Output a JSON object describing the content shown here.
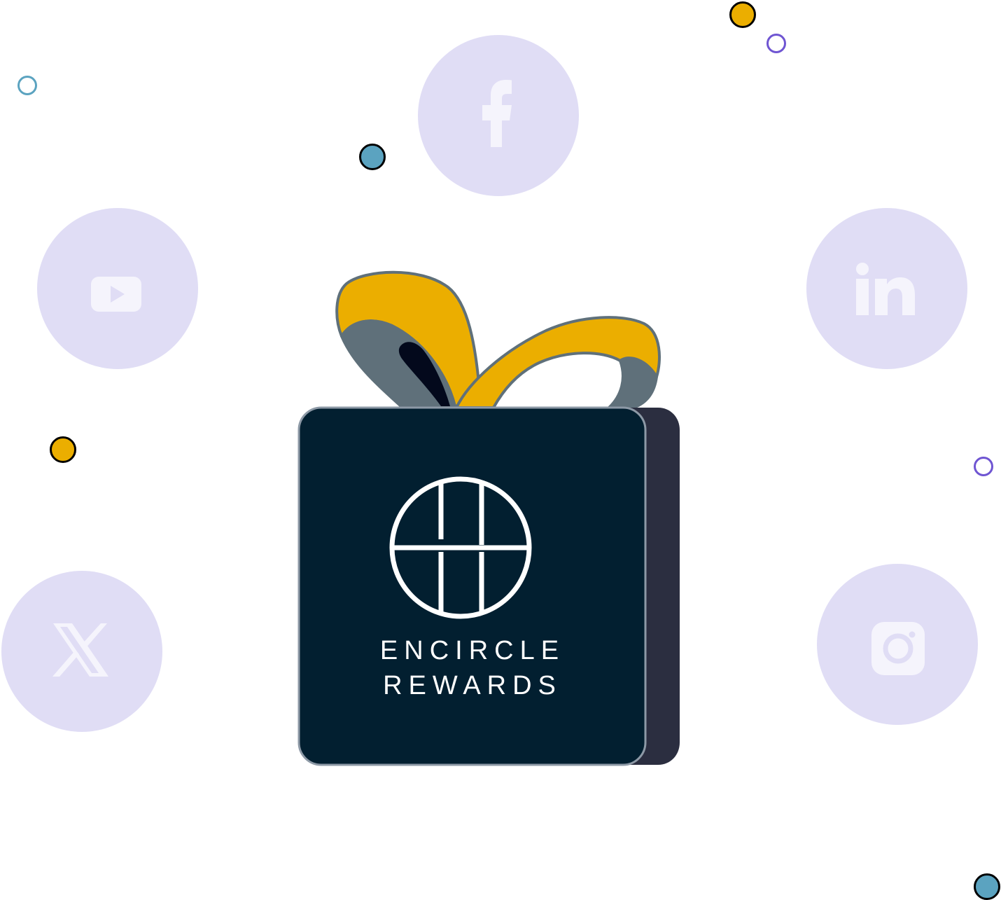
{
  "brand": {
    "line1": "ENCIRCLE",
    "line2": "REWARDS"
  },
  "social_icons": [
    {
      "name": "facebook-icon",
      "glyph": "f"
    },
    {
      "name": "youtube-icon"
    },
    {
      "name": "linkedin-icon",
      "glyph": "in"
    },
    {
      "name": "x-icon"
    },
    {
      "name": "instagram-icon"
    }
  ],
  "colors": {
    "circle_fill": "#e0ddf5",
    "icon_fill": "#f5f4fc",
    "box_front": "#021f30",
    "box_side": "#2b2e40",
    "ribbon_gold": "#ebae00",
    "ribbon_gray": "#5f707a",
    "dot_teal": "#5ba3c0",
    "dot_gold": "#ebae00",
    "ring_purple": "#6f55d2"
  }
}
